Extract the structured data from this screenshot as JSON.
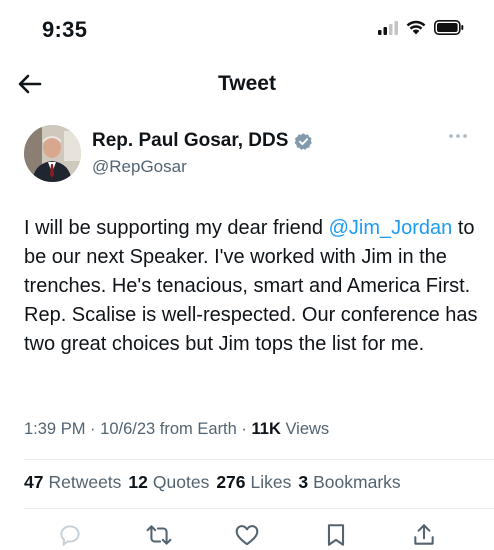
{
  "status_bar": {
    "time": "9:35",
    "icons": [
      "signal-icon",
      "wifi-icon",
      "battery-icon"
    ]
  },
  "header": {
    "title": "Tweet",
    "back_icon": "back-arrow-icon"
  },
  "author": {
    "name": "Rep. Paul Gosar, DDS",
    "handle": "@RepGosar",
    "verified_icon": "verified-badge-icon",
    "more_icon": "more-options-icon"
  },
  "tweet": {
    "before_mention": "I will be supporting my dear friend ",
    "mention": "@Jim_Jordan",
    "after_mention": " to be our next Speaker. I've worked with Jim in the trenches. He's tenacious, smart and America First. Rep. Scalise is well-respected.  Our conference has two great choices but Jim tops the list for me."
  },
  "meta": {
    "time": "1:39 PM",
    "date": "10/6/23",
    "source": "from Earth",
    "views_count": "11K",
    "views_label": "Views"
  },
  "stats": {
    "retweets_count": "47",
    "retweets_label": "Retweets",
    "quotes_count": "12",
    "quotes_label": "Quotes",
    "likes_count": "276",
    "likes_label": "Likes",
    "bookmarks_count": "3",
    "bookmarks_label": "Bookmarks"
  },
  "actions": [
    "reply-icon",
    "retweet-icon",
    "like-icon",
    "bookmark-icon",
    "share-icon"
  ],
  "colors": {
    "text": "#0f1419",
    "secondary": "#536471",
    "link": "#1d9bf0",
    "divider": "#e7e9ea",
    "verified_badge": "#829aab"
  }
}
